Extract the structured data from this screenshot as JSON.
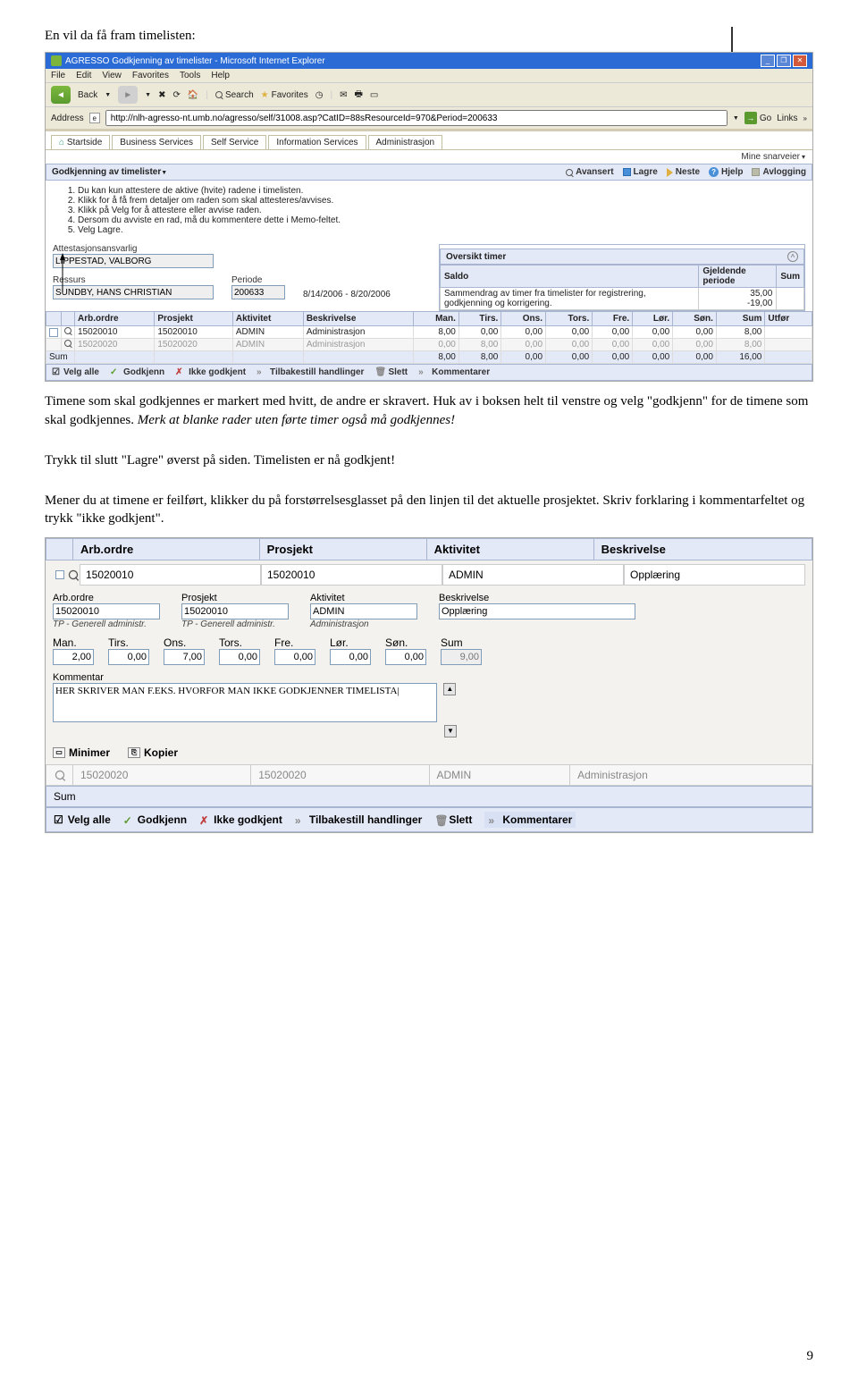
{
  "intro_title": "En vil da få fram timelisten:",
  "para1_a": "Timene som skal godkjennes er markert med hvitt, de andre er skravert. Huk av i boksen helt til venstre og velg \"godkjenn\" for de timene som skal godkjennes. ",
  "para1_b": "Merk at blanke rader uten førte timer også må godkjennes!",
  "para2": "Trykk til slutt \"Lagre\" øverst på siden. Timelisten er nå godkjent!",
  "para3": "Mener du at timene er feilført, klikker du på forstørrelsesglasset på den linjen til det aktuelle prosjektet. Skriv forklaring i kommentarfeltet og trykk \"ikke godkjent\".",
  "page_number": "9",
  "ie": {
    "title": "AGRESSO Godkjenning av timelister - Microsoft Internet Explorer",
    "menu": [
      "File",
      "Edit",
      "View",
      "Favorites",
      "Tools",
      "Help"
    ],
    "back": "Back",
    "search": "Search",
    "favorites": "Favorites",
    "address_label": "Address",
    "address": "http://nlh-agresso-nt.umb.no/agresso/self/31008.asp?CatID=88sResourceId=970&Period=200633",
    "go": "Go",
    "links": "Links"
  },
  "tabs": [
    "Startside",
    "Business Services",
    "Self Service",
    "Information Services",
    "Administrasjon"
  ],
  "shortcuts_label": "Mine snarveier",
  "bluebar_title": "Godkjenning av timelister",
  "bb": {
    "avansert": "Avansert",
    "lagre": "Lagre",
    "neste": "Neste",
    "hjelp": "Hjelp",
    "avlogging": "Avlogging"
  },
  "instr": [
    "Du kan kun attestere de aktive (hvite) radene i timelisten.",
    "Klikk for å få frem detaljer om raden som skal attesteres/avvises.",
    "Klikk på Velg for å attestere eller avvise raden.",
    "Dersom du avviste en rad, må du kommentere dette i Memo-feltet.",
    "Velg Lagre."
  ],
  "f": {
    "att_label": "Attestasjonsansvarlig",
    "att_val": "LIPPESTAD, VALBORG",
    "res_label": "Ressurs",
    "res_val": "SUNDBY, HANS CHRISTIAN",
    "per_label": "Periode",
    "per_val": "200633",
    "date_range": "8/14/2006 - 8/20/2006"
  },
  "ov": {
    "title": "Oversikt timer",
    "saldo": "Saldo",
    "saldo_desc": "Sammendrag av timer fra timelister for registrering, godkjenning og korrigering.",
    "gjeld": "Gjeldende periode",
    "gjeld_val": "35,00",
    "sub": "-19,00",
    "sum": "Sum"
  },
  "th": {
    "arb": "Arb.ordre",
    "pros": "Prosjekt",
    "akt": "Aktivitet",
    "besk": "Beskrivelse",
    "man": "Man.",
    "tirs": "Tirs.",
    "ons": "Ons.",
    "tors": "Tors.",
    "fre": "Fre.",
    "lor": "Lør.",
    "son": "Søn.",
    "sum": "Sum",
    "utf": "Utfør"
  },
  "rows": [
    {
      "arb": "15020010",
      "pros": "15020010",
      "akt": "ADMIN",
      "besk": "Administrasjon",
      "d": [
        "8,00",
        "0,00",
        "0,00",
        "0,00",
        "0,00",
        "0,00",
        "0,00"
      ],
      "sum": "8,00",
      "grey": false
    },
    {
      "arb": "15020020",
      "pros": "15020020",
      "akt": "ADMIN",
      "besk": "Administrasjon",
      "d": [
        "0,00",
        "8,00",
        "0,00",
        "0,00",
        "0,00",
        "0,00",
        "0,00"
      ],
      "sum": "8,00",
      "grey": true
    }
  ],
  "sumrow": {
    "label": "Sum",
    "d": [
      "8,00",
      "8,00",
      "0,00",
      "0,00",
      "0,00",
      "0,00",
      "0,00"
    ],
    "sum": "16,00"
  },
  "ab": {
    "velg": "Velg alle",
    "god": "Godkjenn",
    "ikke": "Ikke godkjent",
    "tilb": "Tilbakestill handlinger",
    "slett": "Slett",
    "komm": "Kommentarer"
  },
  "d2": {
    "hdr": {
      "arb": "Arb.ordre",
      "pros": "Prosjekt",
      "akt": "Aktivitet",
      "besk": "Beskrivelse"
    },
    "row": {
      "arb": "15020010",
      "pros": "15020010",
      "akt": "ADMIN",
      "besk": "Opplæring"
    },
    "lbl": {
      "arb": "Arb.ordre",
      "pros": "Prosjekt",
      "akt": "Aktivitet",
      "besk": "Beskrivelse"
    },
    "val": {
      "arb": "15020010",
      "pros": "15020010",
      "akt": "ADMIN",
      "besk": "Opplæring"
    },
    "sub": {
      "a": "TP - Generell administr.",
      "b": "TP - Generell administr.",
      "c": "Administrasjon"
    },
    "dl": {
      "man": "Man.",
      "tirs": "Tirs.",
      "ons": "Ons.",
      "tors": "Tors.",
      "fre": "Fre.",
      "lor": "Lør.",
      "son": "Søn.",
      "sum": "Sum"
    },
    "dv": {
      "man": "2,00",
      "tirs": "0,00",
      "ons": "7,00",
      "tors": "0,00",
      "fre": "0,00",
      "lor": "0,00",
      "son": "0,00",
      "sum": "9,00"
    },
    "komm_label": "Kommentar",
    "komm_text": "HER SKRIVER MAN F.EKS. HVORFOR MAN IKKE GODKJENNER TIMELISTA|",
    "minimer": "Minimer",
    "kopier": "Kopier",
    "g2": {
      "arb": "15020020",
      "pros": "15020020",
      "akt": "ADMIN",
      "besk": "Administrasjon"
    },
    "sum": "Sum"
  }
}
